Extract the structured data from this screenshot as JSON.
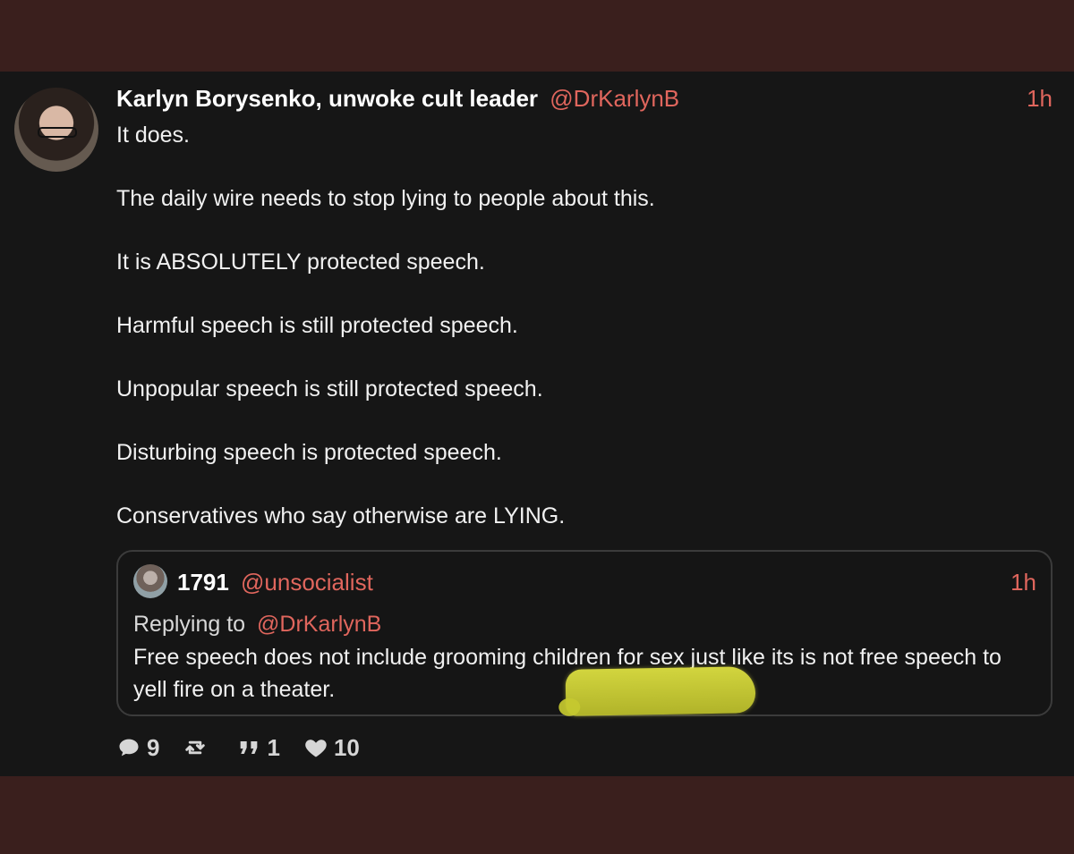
{
  "post": {
    "author_name": "Karlyn Borysenko, unwoke cult leader",
    "handle": "@DrKarlynB",
    "time": "1h",
    "paragraphs": [
      "It does.",
      "The daily wire needs to stop lying to people about this.",
      "It is ABSOLUTELY protected speech.",
      "Harmful speech is still protected speech.",
      "Unpopular speech is still protected speech.",
      "Disturbing speech is protected speech.",
      "Conservatives who say otherwise are LYING."
    ]
  },
  "quote": {
    "author_name": "1791",
    "handle": "@unsocialist",
    "time": "1h",
    "replying_to_label": "Replying to",
    "replying_to_handle": "@DrKarlynB",
    "text": "Free speech does not include grooming children for sex just like its is not free speech to yell fire on a theater."
  },
  "actions": {
    "replies": "9",
    "reblogs": "",
    "quotes": "1",
    "likes": "10",
    "icons": {
      "reply": "comment-bubble-icon",
      "reblog": "repost-icon",
      "quote": "quote-icon",
      "like": "heart-icon"
    }
  },
  "colors": {
    "background": "#161616",
    "outer_frame": "#3a1f1d",
    "accent": "#e0665d",
    "highlight": "#d7da3f"
  }
}
